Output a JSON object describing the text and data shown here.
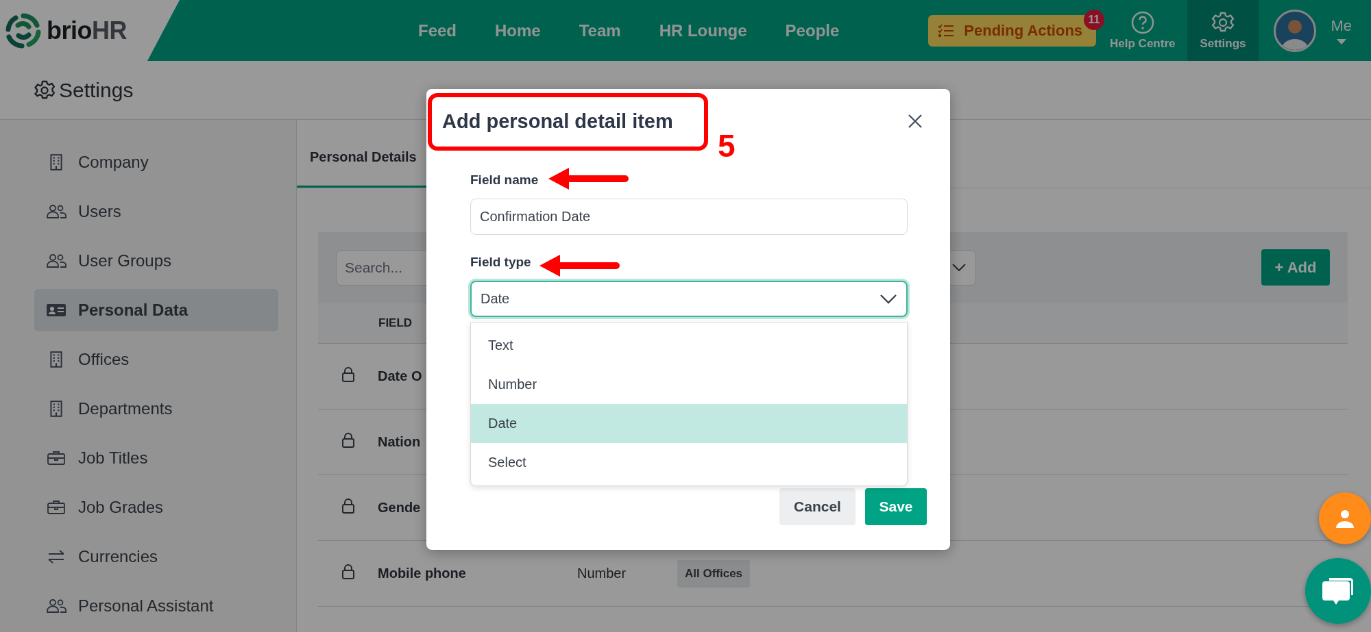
{
  "brand": {
    "name": "brio",
    "suffix": "HR"
  },
  "nav": [
    {
      "label": "Feed"
    },
    {
      "label": "Home"
    },
    {
      "label": "Team"
    },
    {
      "label": "HR Lounge"
    },
    {
      "label": "People"
    }
  ],
  "pending_actions": {
    "label": "Pending Actions",
    "count": "11"
  },
  "utility_items": [
    {
      "label": "Help Centre",
      "kind": "help",
      "selected": false
    },
    {
      "label": "Settings",
      "kind": "settings",
      "selected": true
    }
  ],
  "user": {
    "label": "Me"
  },
  "page_title": "Settings",
  "sidebar": {
    "items": [
      {
        "label": "Company",
        "kind": "building",
        "selected": false
      },
      {
        "label": "Users",
        "kind": "users",
        "selected": false
      },
      {
        "label": "User Groups",
        "kind": "users",
        "selected": false
      },
      {
        "label": "Personal Data",
        "kind": "id-card",
        "selected": true
      },
      {
        "label": "Offices",
        "kind": "building",
        "selected": false
      },
      {
        "label": "Departments",
        "kind": "building",
        "selected": false
      },
      {
        "label": "Job Titles",
        "kind": "briefcase",
        "selected": false
      },
      {
        "label": "Job Grades",
        "kind": "briefcase",
        "selected": false
      },
      {
        "label": "Currencies",
        "kind": "arrows",
        "selected": false
      },
      {
        "label": "Personal Assistant",
        "kind": "users",
        "selected": false
      }
    ]
  },
  "tabs": [
    {
      "label": "Personal Details",
      "selected": true
    }
  ],
  "toolbar": {
    "search": {
      "placeholder": "Search..."
    },
    "add_button": "+ Add"
  },
  "table": {
    "columns": [
      "FIELD"
    ],
    "rows": [
      {
        "locked": true,
        "field": "Date O"
      },
      {
        "locked": true,
        "field": "Nation"
      },
      {
        "locked": true,
        "field": "Gende"
      },
      {
        "locked": true,
        "field": "Mobile phone",
        "type": "Number",
        "offices": "All Offices"
      }
    ]
  },
  "modal": {
    "title": "Add personal detail item",
    "fields": [
      {
        "label": "Field name",
        "kind": "text",
        "value": "Confirmation Date"
      },
      {
        "label": "Field type",
        "kind": "select",
        "value": "Date",
        "expanded": true,
        "options": [
          {
            "label": "Text",
            "selected": false
          },
          {
            "label": "Number",
            "selected": false
          },
          {
            "label": "Date",
            "selected": true
          },
          {
            "label": "Select",
            "selected": false
          }
        ]
      }
    ],
    "buttons": [
      {
        "label": "Cancel",
        "kind": "secondary"
      },
      {
        "label": "Save",
        "kind": "primary"
      }
    ]
  },
  "annotation": {
    "step": "5"
  },
  "floating_buttons": [
    {
      "kind": "profile"
    },
    {
      "kind": "chat"
    }
  ]
}
